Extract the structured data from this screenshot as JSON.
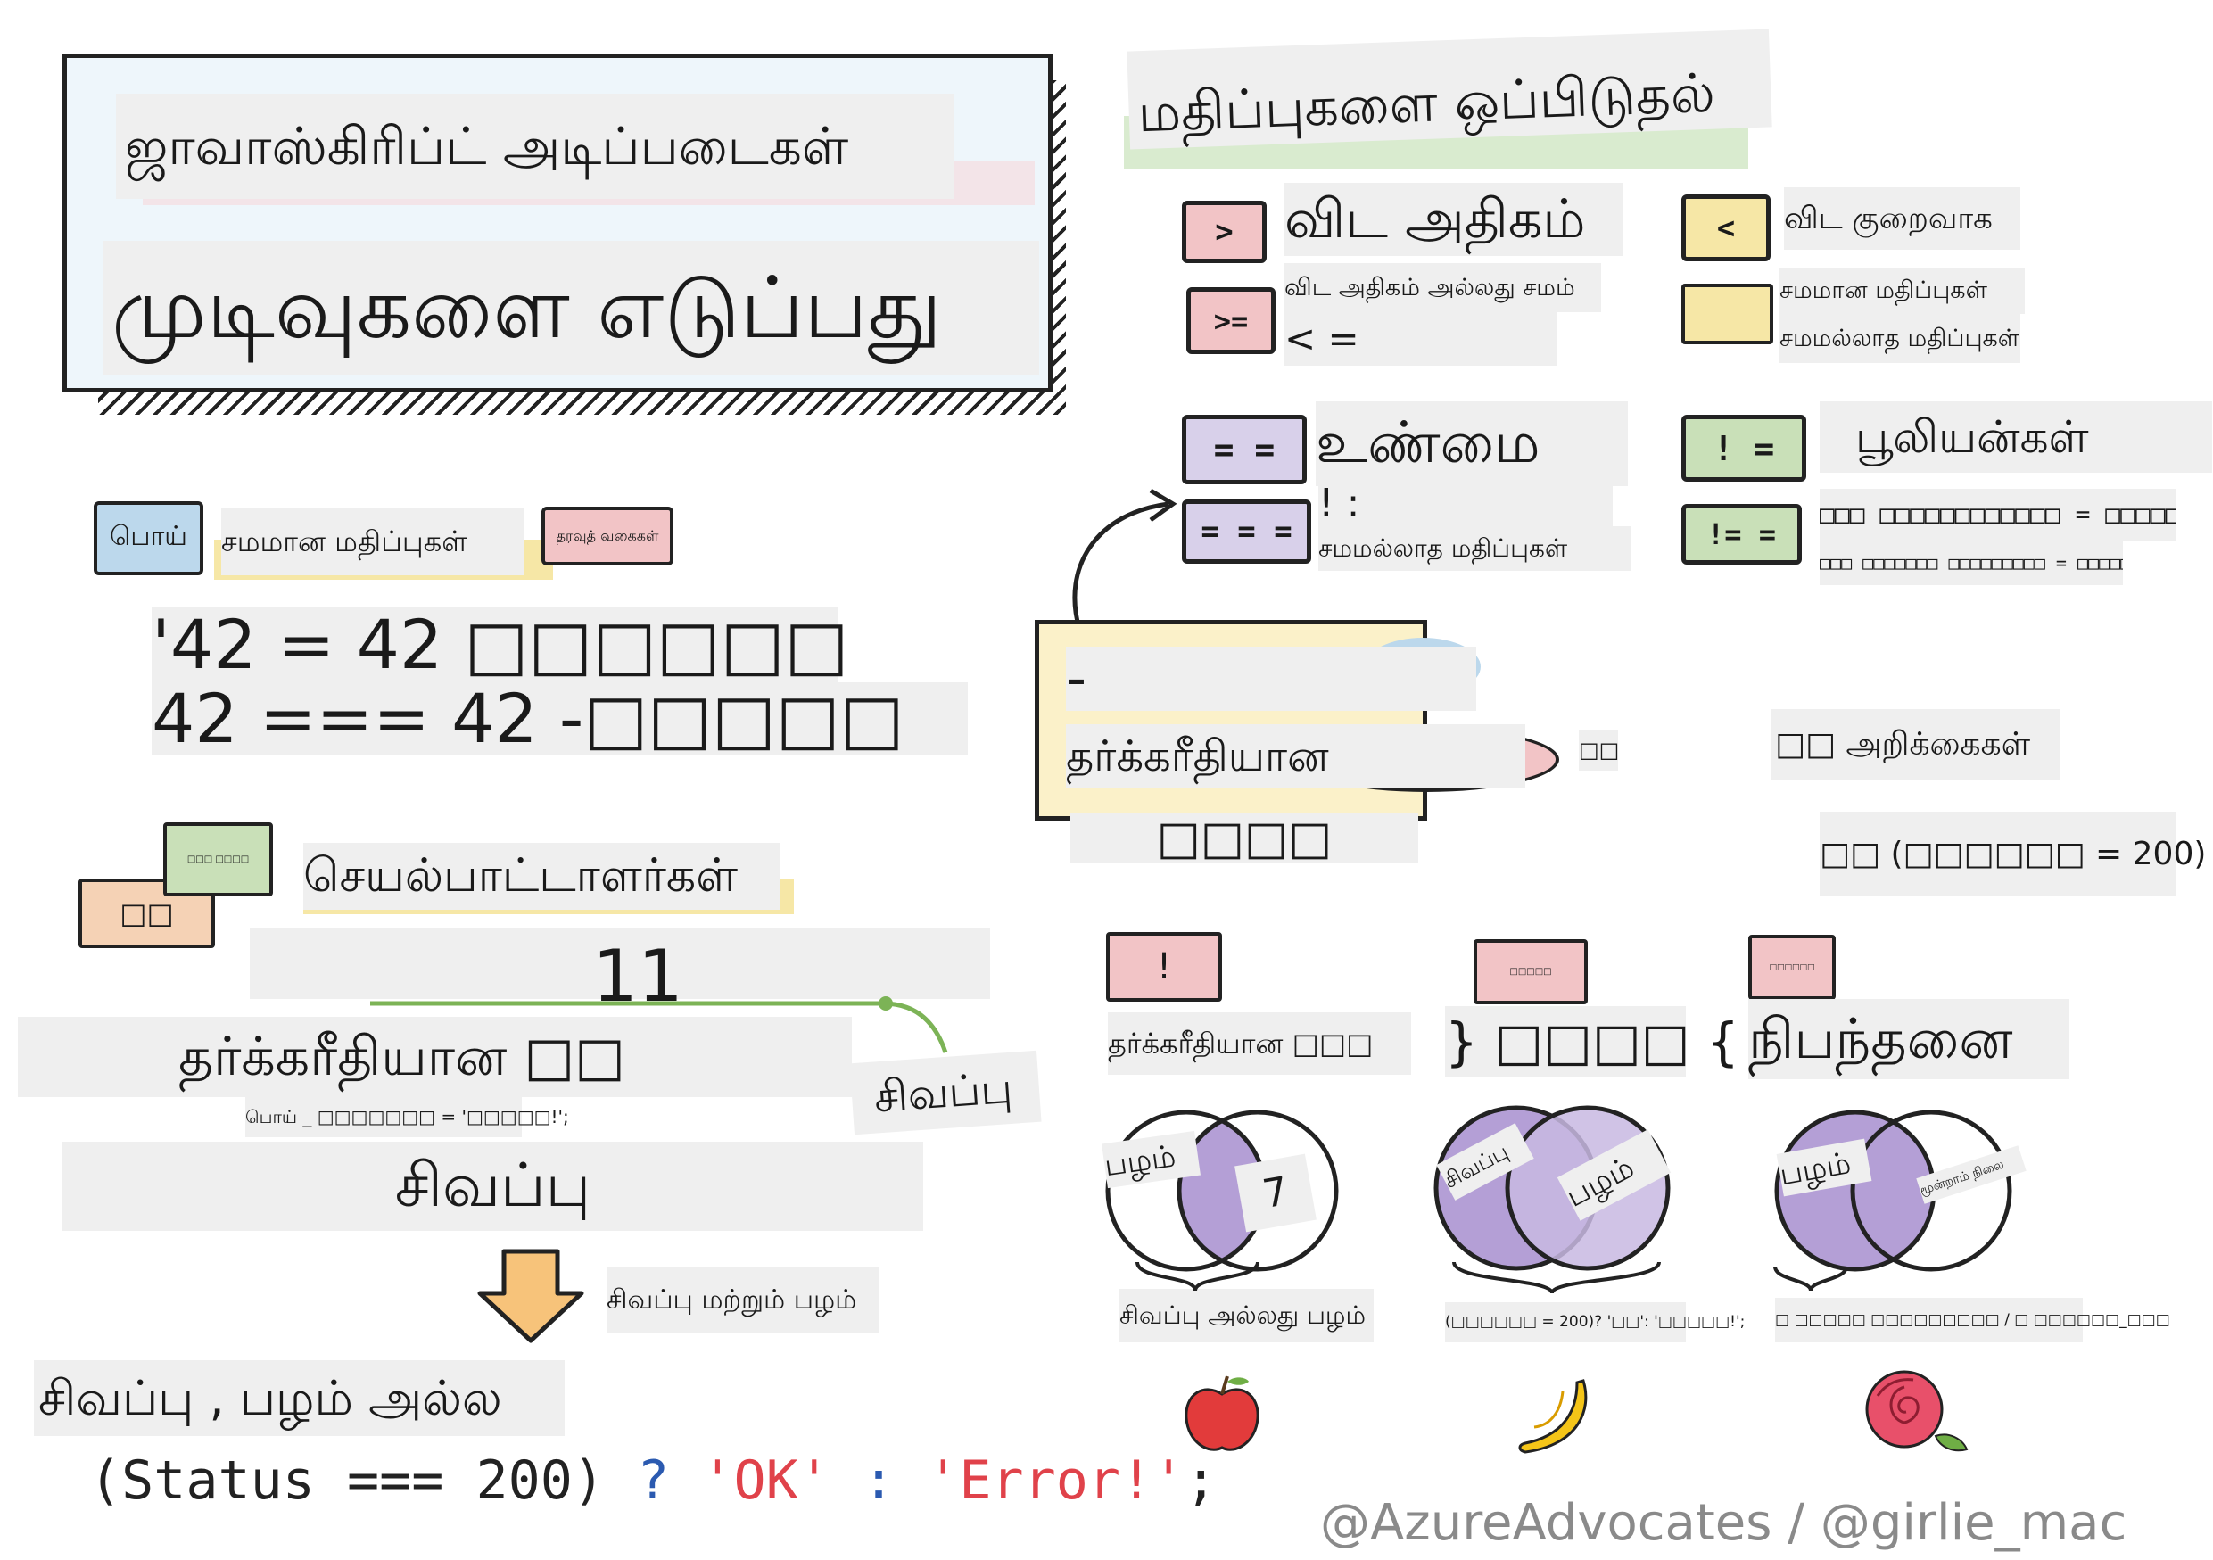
{
  "title": {
    "top": "ஜாவாஸ்கிரிப்ட் அடிப்படைகள்",
    "main": "முடிவுகளை எடுப்பது"
  },
  "comparison": {
    "heading": "மதிப்புகளை ஒப்பிடுதல்",
    "gt_symbol": ">",
    "gt_label": "விட அதிகம்",
    "lt_symbol": "<",
    "lt_label": "விட குறைவாக",
    "gte_symbol": ">=",
    "gte_label": "விட அதிகம் அல்லது சமம்",
    "lte_label": "< =",
    "eq_label": "சமமான மதிப்புகள்",
    "neq_label": "சமமல்லாத மதிப்புகள்",
    "strict_eq_symbol": "= =",
    "strict_eq_label": "உண்மை",
    "neq_symbol": "! =",
    "boolean_label": "பூலியன்கள்",
    "strict_eqq_symbol": "= = =",
    "strict_neq_text": "! :",
    "strict_neq_label": "சமமல்லாத மதிப்புகள்",
    "strict_neq_symbol": "!= =",
    "code_line_1": "□□□ □□□□□□□□□□□□ = □□□□□",
    "code_line_2": "□□□ □□□□□□□ □□□□□□□□□ = □□□□□"
  },
  "equality": {
    "bubble_false": "பொய்",
    "label_equal": "சமமான மதிப்புகள்",
    "bubble_types": "தரவுத் வகைகள்",
    "line_1": "'42 = 42 □□□□□□",
    "line_2": "42 === 42 -□□□□□"
  },
  "logical": {
    "dash": "-",
    "label": "தர்க்கரீதியான",
    "side": "□□",
    "under": "□□□□"
  },
  "if_statements": {
    "label": "□□ அறிக்கைகள்",
    "code": "□□ (□□□□□□ = 200) {"
  },
  "operators": {
    "bubble_left": "□□",
    "bubble_right": "□□□ □□□□",
    "heading": "செயல்பாட்டாளர்கள்",
    "number": "11",
    "logical_label": "தர்க்கரீதியான □□",
    "side_note": "சிவப்பு",
    "code_note": "பொய் _ □□□□□□□ = '□□□□□!';",
    "red": "சிவப்பு",
    "and_label": "சிவப்பு மற்றும் பழம்",
    "not_label": "சிவப்பு , பழம் அல்ல",
    "ternary": {
      "open": "(Status === 200)",
      "q": "?",
      "ok": "'OK'",
      "colon": ":",
      "error": "'Error!'",
      "semi": ";"
    }
  },
  "venn": {
    "not_tag": "!",
    "not_label": "தர்க்கரீதியான □□□",
    "and_tag": "□□□□□",
    "and_label": "} □□□□ {",
    "cond_tag": "□□□□□□",
    "cond_label": "நிபந்தனை",
    "or_left": "பழம்",
    "or_right": "7",
    "or_caption": "சிவப்பு அல்லது பழம்",
    "and_left": "சிவப்பு",
    "and_right": "பழம்",
    "and_caption": "(□□□□□□ = 200)? '□□': '□□□□□!';",
    "cond_left": "பழம்",
    "cond_right": "மூன்றாம் நிலை",
    "cond_caption": "□ □□□□□ □□□□□□□□□ / □ □□□□□□_□□□"
  },
  "credits": "@AzureAdvocates / @girlie_mac",
  "colors": {
    "purple": "#b49fd6",
    "green": "#c9e0b8",
    "pink": "#f2c4c6",
    "yellow": "#f6e7a6",
    "blue": "#bcd8ec",
    "ternary_red": "#e0424a",
    "ternary_blue": "#2b5ab0"
  }
}
